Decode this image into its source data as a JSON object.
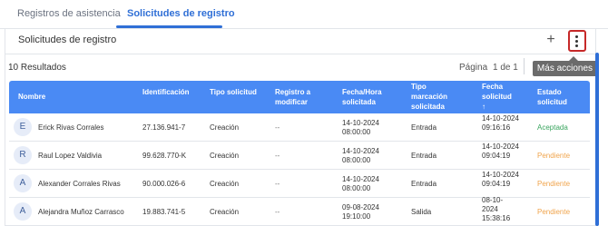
{
  "tabs": [
    {
      "label": "Registros de asistencia"
    },
    {
      "label": "Solicitudes de registro"
    }
  ],
  "panel": {
    "title": "Solicitudes de registro",
    "add_label": "+",
    "more_tooltip": "Más acciones"
  },
  "results_text": "10 Resultados",
  "pagination": {
    "page_label": "Página",
    "of_text": "1 de 1"
  },
  "colors": {
    "accent": "#2f6fd6",
    "header_bg": "#4a8af4",
    "accepted": "#3aa55f",
    "pending": "#f0a44c"
  },
  "table": {
    "columns": [
      {
        "label": "Nombre"
      },
      {
        "label": "Identificación"
      },
      {
        "label": "Tipo solicitud"
      },
      {
        "label": "Registro a\nmodificar"
      },
      {
        "label": "Fecha/Hora\nsolicitada"
      },
      {
        "label": "Tipo\nmarcación\nsolicitada"
      },
      {
        "label": "Fecha\nsolicitud\n↑"
      },
      {
        "label": "Estado\nsolicitud"
      }
    ],
    "rows": [
      {
        "initial": "E",
        "name": "Erick Rivas Corrales",
        "id": "27.136.941-7",
        "type": "Creación",
        "modify": "--",
        "requested_datetime": "14-10-2024\n08:00:00",
        "mark_type": "Entrada",
        "request_date": "14-10-2024\n09:16:16",
        "status": "Aceptada",
        "status_kind": "ok"
      },
      {
        "initial": "R",
        "name": "Raul Lopez Valdivia",
        "id": "99.628.770-K",
        "type": "Creación",
        "modify": "--",
        "requested_datetime": "14-10-2024\n08:00:00",
        "mark_type": "Entrada",
        "request_date": "14-10-2024\n09:04:19",
        "status": "Pendiente",
        "status_kind": "pending"
      },
      {
        "initial": "A",
        "name": "Alexander Corrales Rivas",
        "id": "90.000.026-6",
        "type": "Creación",
        "modify": "--",
        "requested_datetime": "14-10-2024\n08:00:00",
        "mark_type": "Entrada",
        "request_date": "14-10-2024\n09:04:19",
        "status": "Pendiente",
        "status_kind": "pending"
      },
      {
        "initial": "A",
        "name": "Alejandra Muñoz Carrasco",
        "id": "19.883.741-5",
        "type": "Creación",
        "modify": "--",
        "requested_datetime": "09-08-2024\n19:10:00",
        "mark_type": "Salida",
        "request_date": "08-10-\n2024\n15:38:16",
        "status": "Pendiente",
        "status_kind": "pending"
      }
    ]
  }
}
